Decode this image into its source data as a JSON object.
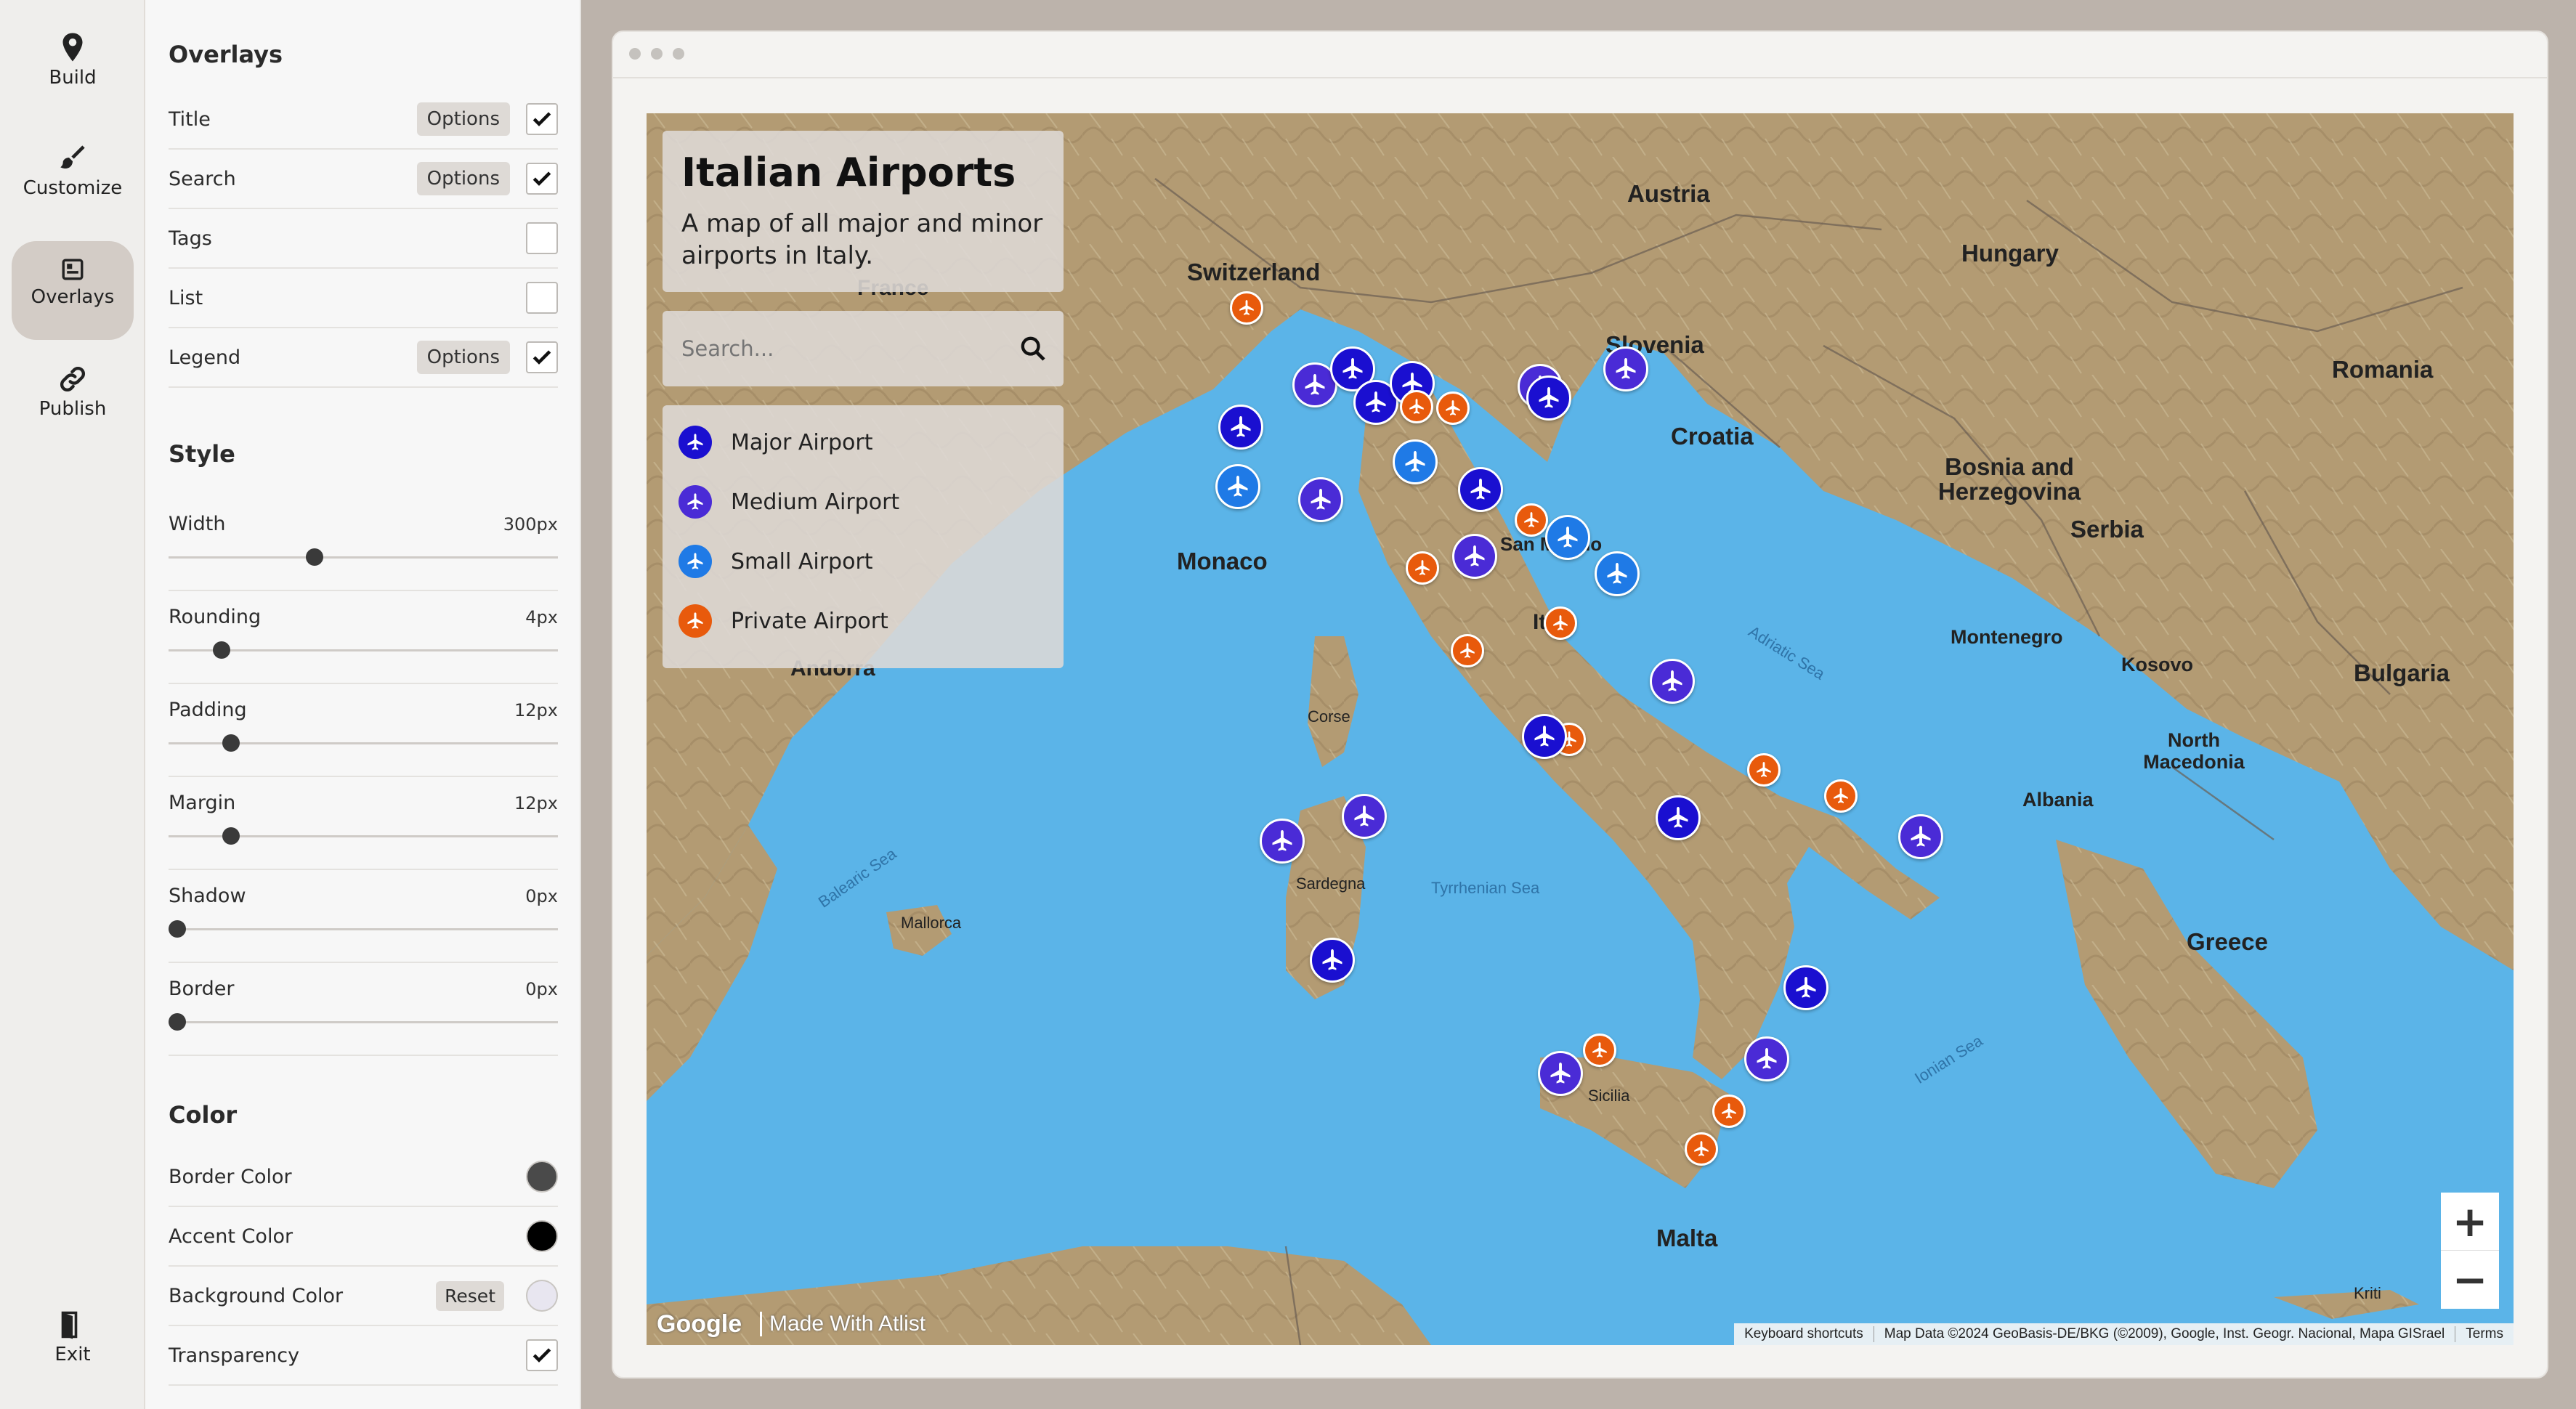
{
  "rail": {
    "items": [
      {
        "label": "Build",
        "icon": "pin-icon"
      },
      {
        "label": "Customize",
        "icon": "brush-icon"
      },
      {
        "label": "Overlays",
        "icon": "overlays-icon"
      },
      {
        "label": "Publish",
        "icon": "link-icon"
      }
    ],
    "exit_label": "Exit"
  },
  "panel": {
    "overlays_title": "Overlays",
    "overlays": [
      {
        "label": "Title",
        "options": "Options",
        "checked": true
      },
      {
        "label": "Search",
        "options": "Options",
        "checked": true
      },
      {
        "label": "Tags",
        "options": "",
        "checked": false
      },
      {
        "label": "List",
        "options": "",
        "checked": false
      },
      {
        "label": "Legend",
        "options": "Options",
        "checked": true
      }
    ],
    "style_title": "Style",
    "sliders": [
      {
        "label": "Width",
        "value": "300px",
        "level": 0.37
      },
      {
        "label": "Rounding",
        "value": "4px",
        "level": 0.12
      },
      {
        "label": "Padding",
        "value": "12px",
        "level": 0.145
      },
      {
        "label": "Margin",
        "value": "12px",
        "level": 0.145
      },
      {
        "label": "Shadow",
        "value": "0px",
        "level": 0.0
      },
      {
        "label": "Border",
        "value": "0px",
        "level": 0.0
      }
    ],
    "color_title": "Color",
    "colors": {
      "border_label": "Border Color",
      "border_color": "#4a4a4a",
      "accent_label": "Accent Color",
      "accent_color": "#000000",
      "background_label": "Background Color",
      "background_reset": "Reset",
      "background_color": "#e8e6f0",
      "transparency_label": "Transparency",
      "transparency_checked": true
    }
  },
  "map": {
    "title": "Italian Airports",
    "description": "A map of all major and minor airports in Italy.",
    "search_placeholder": "Search...",
    "legend": [
      {
        "label": "Major Airport",
        "color": "#1a0fd0"
      },
      {
        "label": "Medium Airport",
        "color": "#4a2bd6"
      },
      {
        "label": "Small Airport",
        "color": "#1f7ae6"
      },
      {
        "label": "Private Airport",
        "color": "#e85a0c"
      }
    ],
    "countries": [
      "Austria",
      "Hungary",
      "Switzerland",
      "France",
      "Slovenia",
      "Romania",
      "Croatia",
      "Bosnia and Herzegovina",
      "Serbia",
      "Monaco",
      "San Marino",
      "Italy",
      "Montenegro",
      "Kosovo",
      "Bulgaria",
      "Andorra",
      "North Macedonia",
      "Albania",
      "Greece",
      "Malta"
    ],
    "seas": [
      "Adriatic Sea",
      "Balearic Sea",
      "Tyrrhenian Sea",
      "Ionian Sea"
    ],
    "places": [
      "Corse",
      "Sardegna",
      "Mallorca",
      "Sicilia",
      "Kriti"
    ],
    "attribution": {
      "google": "Google",
      "made_with": "Made With Atlist",
      "shortcuts": "Keyboard shortcuts",
      "map_data": "Map Data ©2024 GeoBasis-DE/BKG (©2009), Google, Inst. Geogr. Nacional, Mapa GISrael",
      "terms": "Terms"
    },
    "zoom_in": "+",
    "zoom_out": "−"
  }
}
